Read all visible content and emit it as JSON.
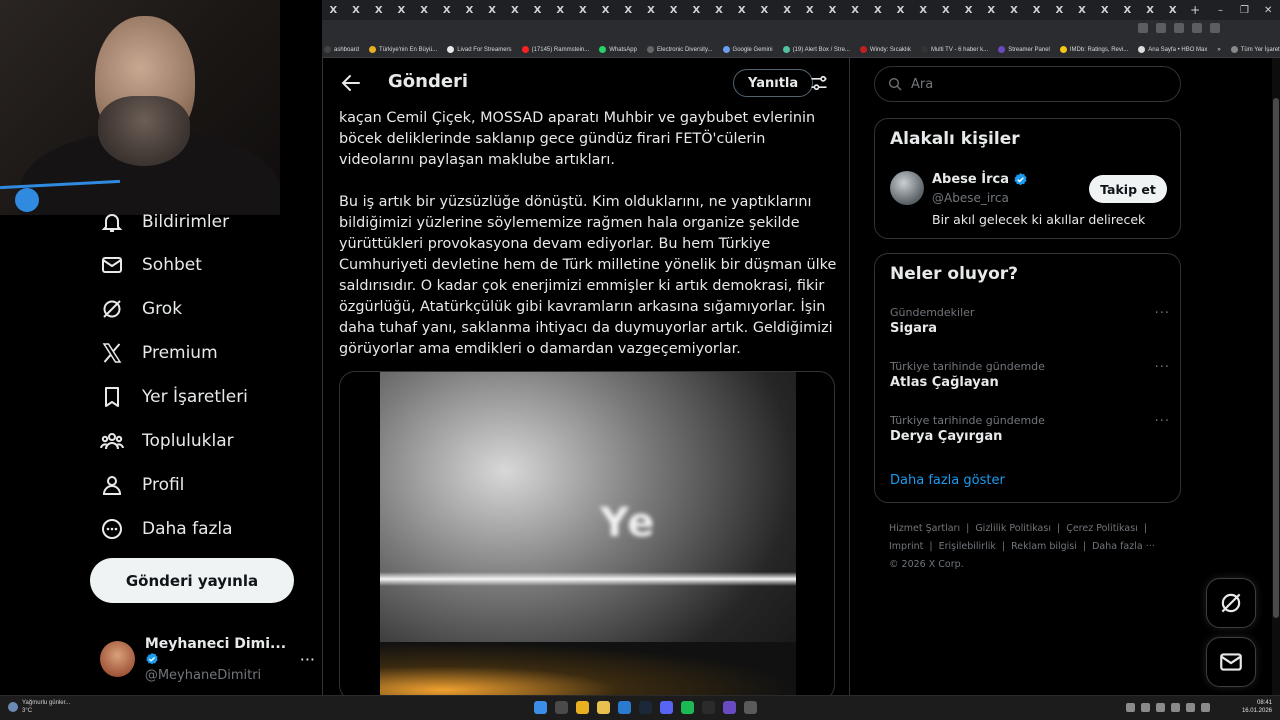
{
  "browser": {
    "tab_close_glyph": "X",
    "tab_count": 38,
    "new_tab_glyph": "+",
    "window_minimize": "–",
    "window_maximize": "❐",
    "window_close": "✕",
    "bookmarks": [
      {
        "label": "ashboard",
        "color": "#444"
      },
      {
        "label": "Türkiye'nin En Büyü...",
        "color": "#e8b020"
      },
      {
        "label": "Livad For Streamers",
        "color": "#e8e8e8"
      },
      {
        "label": "(17145) Rammstein...",
        "color": "#ff2020"
      },
      {
        "label": "WhatsApp",
        "color": "#25d366"
      },
      {
        "label": "Electronic Diversity...",
        "color": "#666"
      },
      {
        "label": "Google Gemini",
        "color": "#6a9ef0"
      },
      {
        "label": "(19) Alert Box / Stre...",
        "color": "#53c0a0"
      },
      {
        "label": "Windy: Sıcaklık",
        "color": "#c02020"
      },
      {
        "label": "Multi TV - 6 haber k...",
        "color": "#333"
      },
      {
        "label": "Streamer Panel",
        "color": "#6a4ac0"
      },
      {
        "label": "IMDb: Ratings, Revi...",
        "color": "#f5c518"
      },
      {
        "label": "Ana Sayfa • HBO Max",
        "color": "#ddd"
      },
      {
        "label": "»",
        "color": ""
      },
      {
        "label": "Tüm Yer İşaretleri",
        "color": "#888"
      }
    ]
  },
  "nav": {
    "items": [
      {
        "label": "Bildirimler",
        "icon": "bell-icon"
      },
      {
        "label": "Sohbet",
        "icon": "mail-icon"
      },
      {
        "label": "Grok",
        "icon": "grok-icon"
      },
      {
        "label": "Premium",
        "icon": "x-logo-icon"
      },
      {
        "label": "Yer İşaretleri",
        "icon": "bookmark-icon"
      },
      {
        "label": "Topluluklar",
        "icon": "communities-icon"
      },
      {
        "label": "Profil",
        "icon": "person-icon"
      },
      {
        "label": "Daha fazla",
        "icon": "more-circle-icon"
      }
    ],
    "post_button": "Gönderi yayınla",
    "account": {
      "name": "Meyhaneci Dimi...",
      "handle": "@MeyhaneDimitri",
      "more": "···"
    }
  },
  "main": {
    "title": "Gönderi",
    "reply_button": "Yanıtla",
    "paragraphs": [
      "kaçan Cemil Çiçek, MOSSAD aparatı Muhbir ve gaybubet evlerinin böcek deliklerinde saklanıp gece gündüz firari FETÖ'cülerin videolarını paylaşan maklube artıkları.",
      "Bu iş artık bir yüzsüzlüğe dönüştü. Kim olduklarını, ne yaptıklarını bildiğimizi yüzlerine söylememize rağmen hala organize şekilde yürüttükleri provokasyona devam ediyorlar. Bu hem Türkiye Cumhuriyeti devletine hem de Türk milletine yönelik bir düşman ülke saldırısıdır. O kadar çok enerjimizi emmişler ki artık demokrasi, fikir özgürlüğü, Atatürkçülük gibi kavramların arkasına sığamıyorlar. İşin daha tuhaf yanı, saklanma ihtiyacı da duymuyorlar artık. Geldiğimizi görüyorlar ama emdikleri o damardan vazgeçemiyorlar."
    ],
    "video_overlay_text": "Ye"
  },
  "sidebar": {
    "search_placeholder": "Ara",
    "related": {
      "title": "Alakalı kişiler",
      "name": "Abese İrca",
      "handle": "@Abese_irca",
      "bio": "Bir akıl gelecek ki akıllar delirecek",
      "follow_button": "Takip et"
    },
    "trends": {
      "title": "Neler oluyor?",
      "items": [
        {
          "context": "Gündemdekiler",
          "name": "Sigara"
        },
        {
          "context": "Türkiye tarihinde gündemde",
          "name": "Atlas Çağlayan"
        },
        {
          "context": "Türkiye tarihinde gündemde",
          "name": "Derya Çayırgan"
        }
      ],
      "more_glyph": "···",
      "show_more": "Daha fazla göster"
    },
    "footer": {
      "links_row1": [
        "Hizmet Şartları",
        "|",
        "Gizlilik Politikası",
        "|",
        "Çerez Politikası",
        "|"
      ],
      "links_row2": [
        "Imprint",
        "|",
        "Erişilebilirlik",
        "|",
        "Reklam bilgisi",
        "|",
        "Daha fazla ···"
      ],
      "copyright": "© 2026 X Corp."
    }
  },
  "taskbar": {
    "weather_text": "Yağmurlu günler...",
    "temperature": "3°C",
    "time": "08:41",
    "date": "16.01.2026"
  },
  "colors": {
    "accent": "#1d9bf0",
    "verified": "#1d9bf0",
    "background": "#000000",
    "border": "#2f3336",
    "muted_text": "#71767b"
  }
}
